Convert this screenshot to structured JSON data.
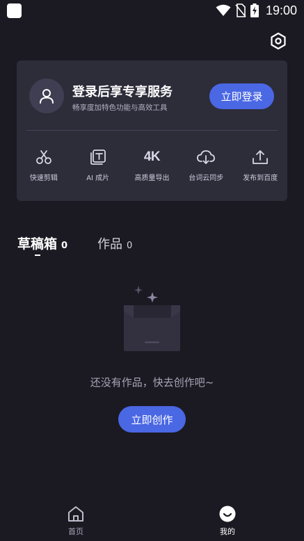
{
  "status_bar": {
    "time": "19:00",
    "icons": [
      "app-icon",
      "wifi-icon",
      "no-sim-icon",
      "battery-charging-icon"
    ]
  },
  "header": {
    "settings_icon": "settings-hexagon-icon"
  },
  "login_card": {
    "avatar_icon": "user-icon",
    "title": "登录后享专享服务",
    "subtitle": "畅享度加特色功能与高效工具",
    "button_label": "立即登录",
    "features": [
      {
        "icon": "scissors-icon",
        "label": "快速剪辑"
      },
      {
        "icon": "ai-text-icon",
        "label": "AI 成片"
      },
      {
        "icon": "4k-icon",
        "icon_text": "4K",
        "label": "高质量导出"
      },
      {
        "icon": "cloud-download-icon",
        "label": "台词云同步"
      },
      {
        "icon": "upload-icon",
        "label": "发布到百度"
      }
    ]
  },
  "tabs": [
    {
      "label": "草稿箱",
      "count": "0",
      "active": true
    },
    {
      "label": "作品",
      "count": "0",
      "active": false
    }
  ],
  "empty_state": {
    "illustration": "empty-box-icon",
    "message": "还没有作品，快去创作吧~",
    "button_label": "立即创作"
  },
  "bottom_nav": [
    {
      "icon": "home-icon",
      "label": "首页",
      "active": false
    },
    {
      "icon": "smile-icon",
      "label": "我的",
      "active": true
    }
  ],
  "colors": {
    "background": "#1b1a22",
    "card": "#2d2c39",
    "accent": "#4a67e4",
    "muted_text": "#a8a6b8"
  }
}
